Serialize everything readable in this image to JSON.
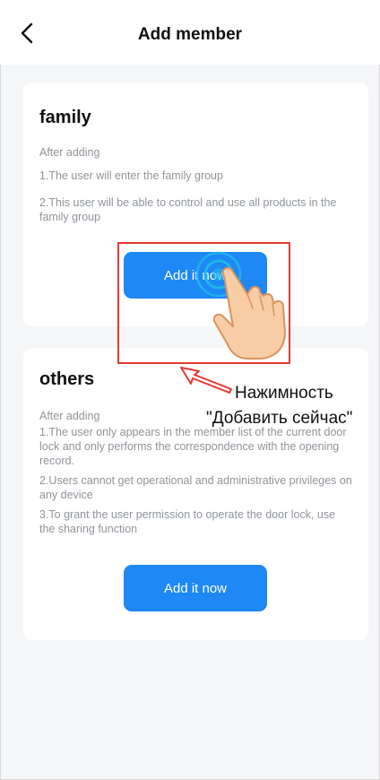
{
  "header": {
    "title": "Add member"
  },
  "family": {
    "title": "family",
    "intro": "After adding",
    "items": [
      "1.The user will enter the family group",
      "2.This user will be able to control and use all products in the family group"
    ],
    "button_label": "Add it now"
  },
  "others": {
    "title": "others",
    "intro": "After adding",
    "items": [
      "1.The user only appears in the member list of the current door lock and only performs the correspondence with the opening record.",
      "2.Users cannot get operational and administrative privileges on any device",
      "3.To grant the user permission to operate the door lock, use the sharing function"
    ],
    "button_label": "Add it now"
  },
  "annotation": {
    "line1": "Нажимность",
    "line2": "\"Добавить сейчас\""
  },
  "colors": {
    "accent": "#1e88f5",
    "highlight": "#e53935",
    "background": "#f5f6f8"
  },
  "icons": [
    "back-arrow-icon",
    "tap-hand-icon",
    "pointer-arrow-icon"
  ]
}
